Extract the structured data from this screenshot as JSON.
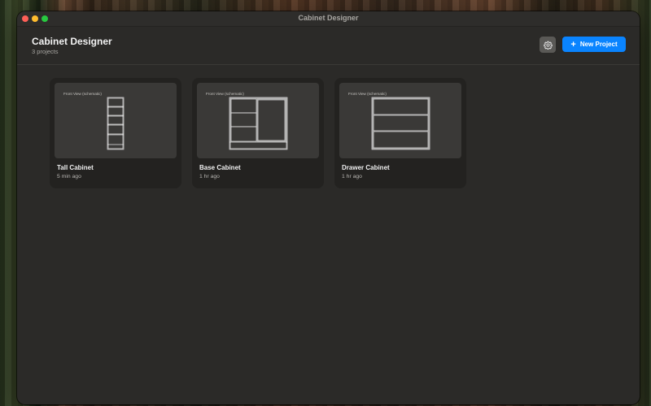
{
  "window": {
    "title": "Cabinet Designer"
  },
  "header": {
    "title": "Cabinet Designer",
    "subtitle": "3 projects",
    "settings_icon": "gear-icon",
    "new_project_label": "New Project",
    "new_project_icon": "plus-icon",
    "accent": "#0a84ff"
  },
  "projects": [
    {
      "name": "Tall Cabinet",
      "time": "5 min ago",
      "preview_label": "Front View (schematic)"
    },
    {
      "name": "Base Cabinet",
      "time": "1 hr ago",
      "preview_label": "Front View (schematic)"
    },
    {
      "name": "Drawer Cabinet",
      "time": "1 hr ago",
      "preview_label": "Front View (schematic)"
    }
  ]
}
